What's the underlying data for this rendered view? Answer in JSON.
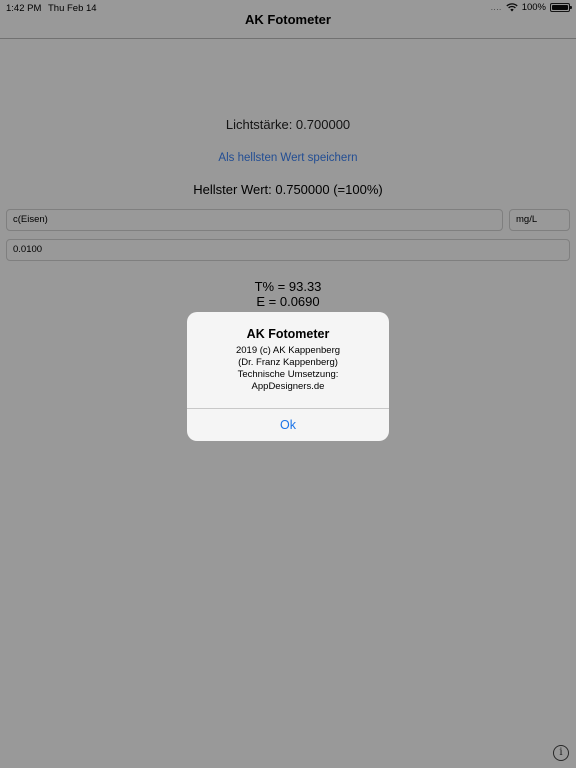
{
  "status_bar": {
    "time": "1:42 PM",
    "date": "Thu Feb 14",
    "signal_dots": "....",
    "battery_percent": "100%",
    "battery_level": 1.0
  },
  "nav": {
    "title": "AK Fotometer"
  },
  "main": {
    "light_intensity": "Lichtstärke: 0.700000",
    "save_brightest_label": "Als hellsten Wert speichern",
    "brightest_value": "Hellster Wert: 0.750000 (=100%)",
    "substance_field": "c(Eisen)",
    "unit_field": "mg/L",
    "concentration_field": "0.0100",
    "transmission": "T% = 93.33",
    "extinction": "E = 0.0690",
    "info_icon": "i"
  },
  "alert": {
    "title": "AK Fotometer",
    "message_lines": [
      "2019 (c) AK Kappenberg",
      "(Dr. Franz Kappenberg)",
      "Technische Umsetzung:",
      "AppDesigners.de"
    ],
    "ok_label": "Ok"
  },
  "colors": {
    "accent": "#1a73e8",
    "overlay": "rgba(0,0,0,0.40)"
  }
}
